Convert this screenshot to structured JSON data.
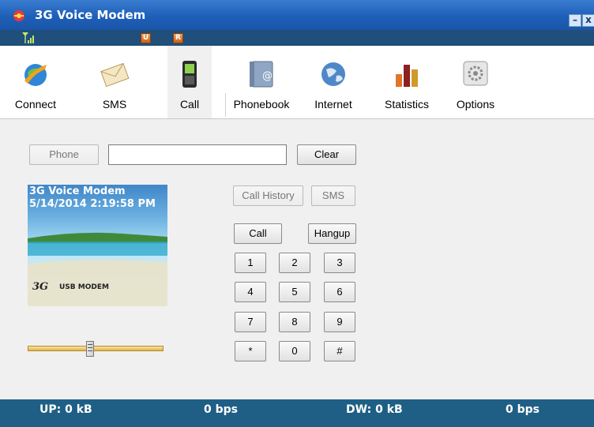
{
  "window": {
    "title": "3G Voice Modem",
    "minimize_glyph": "–",
    "close_glyph": "x"
  },
  "status": {
    "badges": [
      "U",
      "R"
    ],
    "signal_icon": "signal-bars-icon"
  },
  "toolbar": {
    "items": [
      {
        "label": "Connect",
        "icon": "globe-arrow-icon"
      },
      {
        "label": "SMS",
        "icon": "envelope-icon"
      },
      {
        "label": "Call",
        "icon": "mobile-phone-icon"
      },
      {
        "label": "Phonebook",
        "icon": "address-book-icon"
      },
      {
        "label": "Internet",
        "icon": "internet-globe-icon"
      },
      {
        "label": "Statistics",
        "icon": "bar-chart-icon"
      },
      {
        "label": "Options",
        "icon": "gear-icon"
      }
    ],
    "active": "Call"
  },
  "call": {
    "phone_button": "Phone",
    "number_input": "",
    "clear_button": "Clear",
    "screen": {
      "line1": "3G Voice Modem",
      "line2": "5/14/2014 2:19:58 PM",
      "logo_3g": "3G",
      "logo_text": "USB MODEM"
    },
    "call_history_button": "Call History",
    "sms_button": "SMS",
    "call_button": "Call",
    "hangup_button": "Hangup",
    "keypad": [
      "1",
      "2",
      "3",
      "4",
      "5",
      "6",
      "7",
      "8",
      "9",
      "*",
      "0",
      "#"
    ],
    "volume_level": 0.46
  },
  "footer": {
    "up": "UP: 0 kB",
    "up_rate": "0 bps",
    "down": "DW: 0 kB",
    "down_rate": "0 bps"
  },
  "colors": {
    "titlebar": "#1e5fb8",
    "status_strip": "#1f4f7a",
    "footer": "#1f5f86"
  }
}
